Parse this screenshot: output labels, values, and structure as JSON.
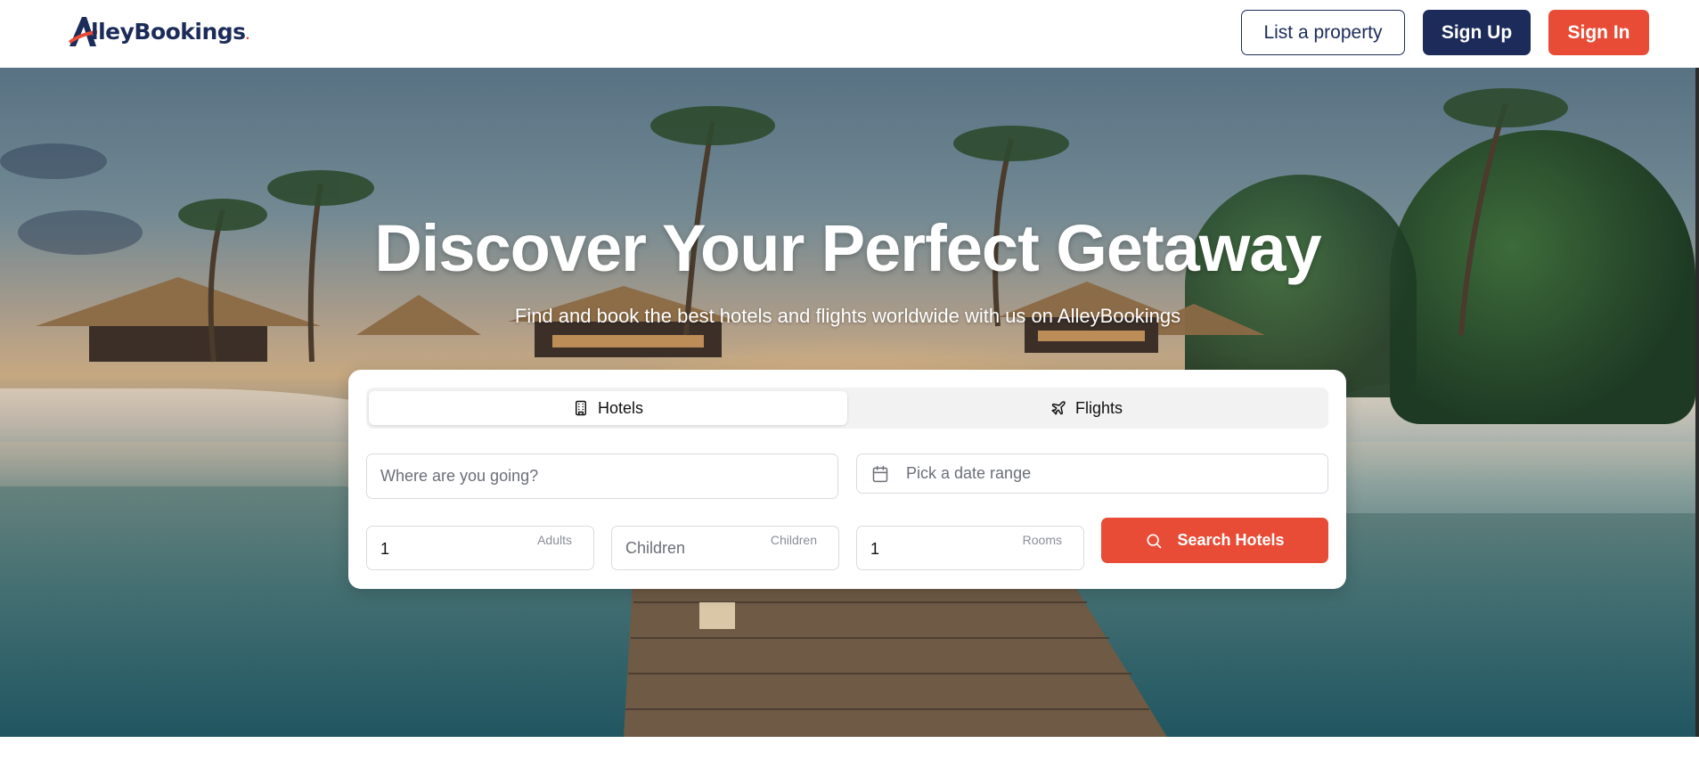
{
  "header": {
    "logo": {
      "first_letter": "A",
      "rest": "lleyBookings",
      "tail": "."
    },
    "list_property_label": "List a property",
    "sign_up_label": "Sign Up",
    "sign_in_label": "Sign In"
  },
  "hero": {
    "title": "Discover Your Perfect Getaway",
    "subtitle": "Find and book the best hotels and flights worldwide with us on AlleyBookings"
  },
  "search": {
    "tabs": [
      {
        "label": "Hotels",
        "icon": "building-icon",
        "active": true
      },
      {
        "label": "Flights",
        "icon": "plane-icon",
        "active": false
      }
    ],
    "destination": {
      "placeholder": "Where are you going?",
      "value": ""
    },
    "dates": {
      "placeholder": "Pick a date range",
      "icon": "calendar-icon"
    },
    "adults": {
      "value": "1",
      "label": "Adults"
    },
    "children": {
      "placeholder": "Children",
      "label": "Children"
    },
    "rooms": {
      "value": "1",
      "label": "Rooms"
    },
    "submit_label": "Search Hotels",
    "submit_icon": "search-icon"
  },
  "colors": {
    "brand_navy": "#1c2b5a",
    "brand_accent": "#e84c36",
    "card_bg": "#ffffff"
  }
}
